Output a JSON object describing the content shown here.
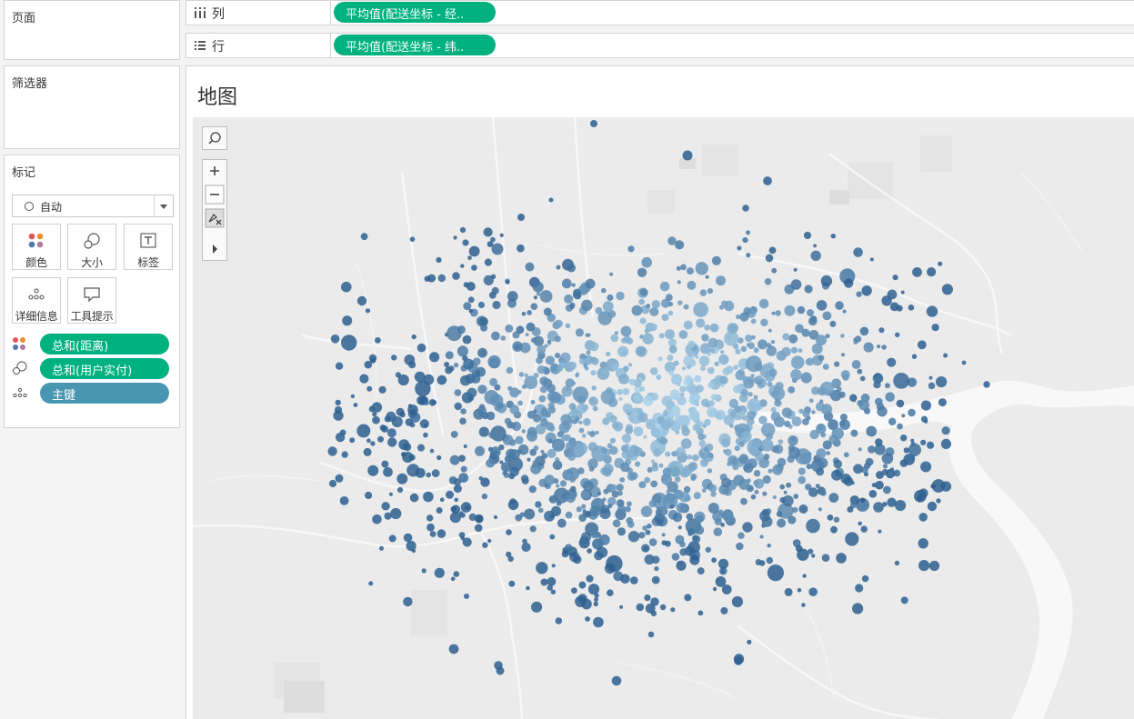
{
  "sidebar": {
    "pages_title": "页面",
    "filters_title": "筛选器",
    "marks_title": "标记",
    "mark_type": {
      "label": "自动",
      "icon": "circle-outline-icon"
    },
    "mark_buttons": [
      {
        "label": "颜色",
        "icon": "color-dots-icon"
      },
      {
        "label": "大小",
        "icon": "size-circles-icon"
      },
      {
        "label": "标签",
        "icon": "text-t-icon"
      },
      {
        "label": "详细信息",
        "icon": "detail-dots-icon"
      },
      {
        "label": "工具提示",
        "icon": "tooltip-bubble-icon"
      }
    ],
    "mark_pills": [
      {
        "label": "总和(距离)",
        "encoding": "color",
        "color": "#00b180"
      },
      {
        "label": "总和(用户实付)",
        "encoding": "size",
        "color": "#00b180"
      },
      {
        "label": "主键",
        "encoding": "detail",
        "color": "#4996b2"
      }
    ]
  },
  "shelves": {
    "columns": {
      "label": "列",
      "pill": "平均值(配送坐标 - 经.."
    },
    "rows": {
      "label": "行",
      "pill": "平均值(配送坐标 - 纬.."
    }
  },
  "view": {
    "title": "地图",
    "map_tools": [
      "search-icon",
      "zoom-in-icon",
      "zoom-out-icon",
      "pin-reset-icon",
      "expand-arrow-icon"
    ]
  },
  "colors": {
    "accent_green": "#00b180",
    "detail_blue": "#4996b2",
    "map_background": "#ebebeb",
    "river": "#f8f8f8",
    "point_light": "#a9d1ea",
    "point_dark": "#2d5f8f"
  }
}
